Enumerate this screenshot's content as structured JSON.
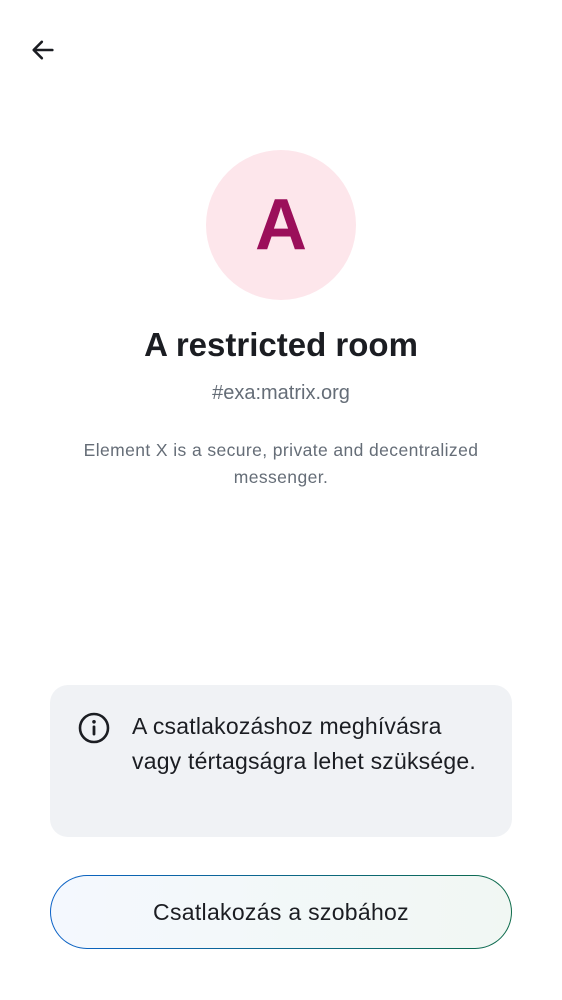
{
  "header": {
    "back_icon": "arrow-left-icon"
  },
  "room": {
    "avatar_letter": "A",
    "avatar_bg_color": "#fde6eb",
    "avatar_fg_color": "#9b0f5a",
    "title": "A restricted room",
    "alias": "#exa:matrix.org",
    "topic": "Element X is a secure, private and decentralized messenger."
  },
  "notice": {
    "icon": "info-icon",
    "text": "A csatlakozáshoz meghívásra vagy tértagságra lehet szüksége."
  },
  "actions": {
    "join_label": "Csatlakozás a szobához"
  }
}
